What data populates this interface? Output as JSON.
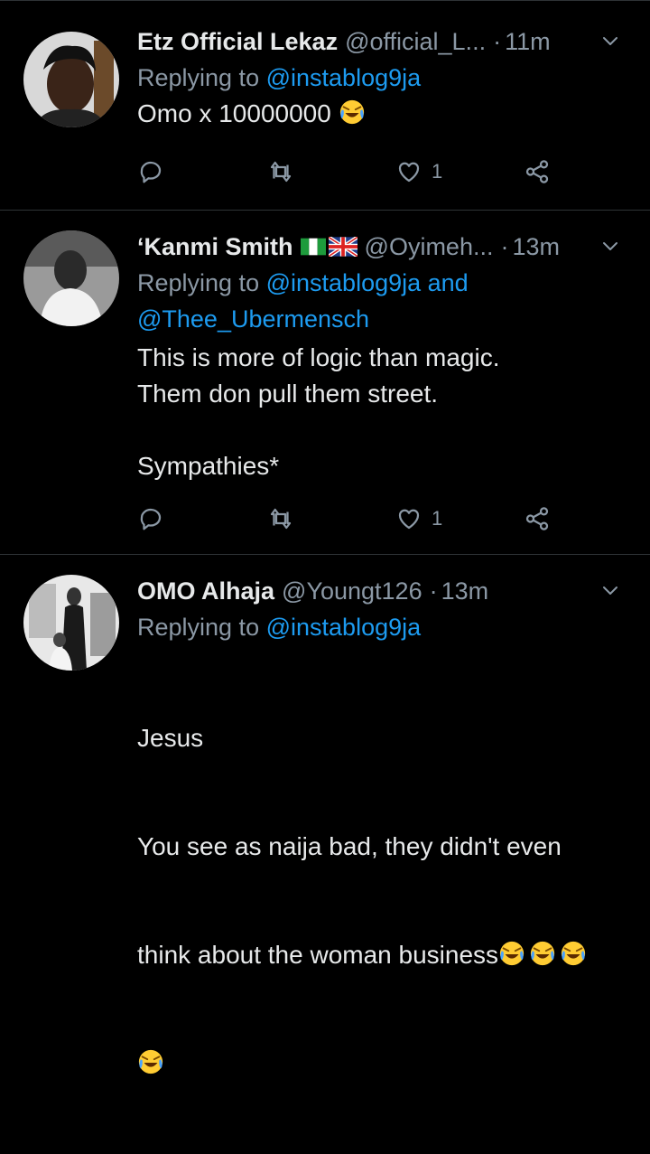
{
  "tweets": [
    {
      "name": "Etz Official Lekaz",
      "handle": "@official_L...",
      "time": "11m",
      "replying_prefix": "Replying to",
      "replying_to": "@instablog9ja",
      "replying_to_2": "",
      "body": "Omo x 10000000",
      "likes": "1"
    },
    {
      "name": "‘Kanmi Smith",
      "handle": "@Oyimeh...",
      "time": "13m",
      "replying_prefix": "Replying to",
      "replying_to": "@instablog9ja and",
      "replying_to_2": "@Thee_Ubermensch",
      "body": "This is more of logic than magic.\nThem don pull them street.\n\nSympathies*",
      "likes": "1"
    },
    {
      "name": "OMO Alhaja",
      "handle": "@Youngt126",
      "time": "13m",
      "replying_prefix": "Replying to",
      "replying_to": "@instablog9ja",
      "replying_to_2": "",
      "body_line1": "Jesus",
      "body_line2": "You see as naija bad, they didn't even",
      "body_line3": "think about the woman business",
      "likes": ""
    }
  ],
  "colors": {
    "background": "#000000",
    "text": "#e7e9ea",
    "muted": "#8b98a5",
    "link": "#1d9bf0",
    "divider": "#2f3336"
  },
  "icons": [
    "reply-icon",
    "retweet-icon",
    "like-icon",
    "share-icon",
    "chevron-down-icon",
    "laughing-emoji-icon",
    "nigeria-flag-icon",
    "uk-flag-icon"
  ]
}
